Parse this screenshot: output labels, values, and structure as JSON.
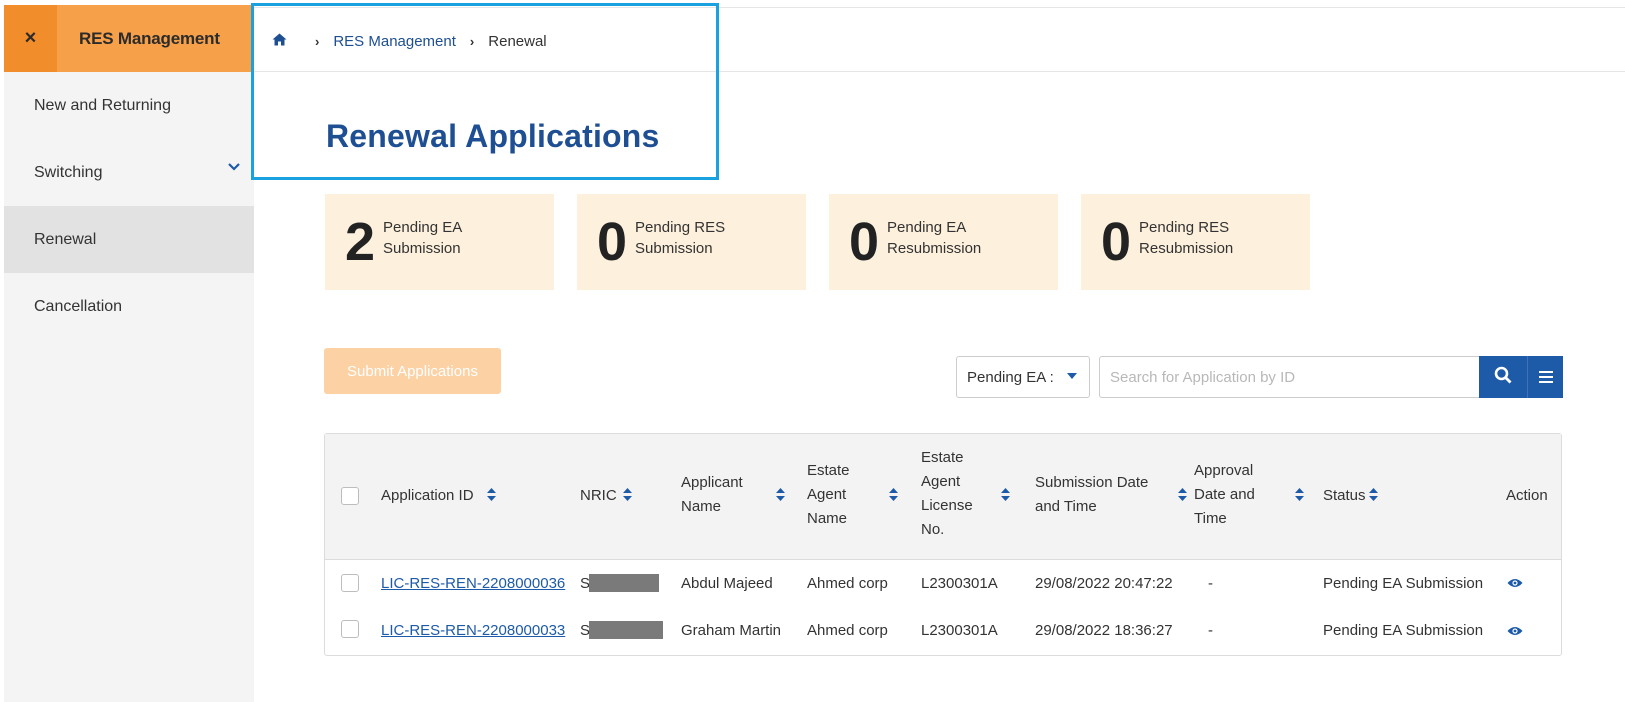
{
  "sidebar": {
    "close_icon": "×",
    "title": "RES Management",
    "items": [
      {
        "label": "New and Returning"
      },
      {
        "label": "Switching"
      },
      {
        "label": "Renewal"
      },
      {
        "label": "Cancellation"
      }
    ]
  },
  "breadcrumb": {
    "home_icon": "home-icon",
    "items": [
      "RES Management",
      "Renewal"
    ]
  },
  "page": {
    "title": "Renewal Applications"
  },
  "stats": [
    {
      "count": "2",
      "line1": "Pending EA",
      "line2": "Submission"
    },
    {
      "count": "0",
      "line1": "Pending RES",
      "line2": "Submission"
    },
    {
      "count": "0",
      "line1": "Pending EA",
      "line2": "Resubmission"
    },
    {
      "count": "0",
      "line1": "Pending RES",
      "line2": "Resubmission"
    }
  ],
  "controls": {
    "submit_label": "Submit Applications",
    "filter_value": "Pending EA :",
    "search_placeholder": "Search for Application by ID"
  },
  "table": {
    "headers": {
      "application_id": "Application ID",
      "nric": "NRIC",
      "applicant_1": "Applicant",
      "applicant_2": "Name",
      "agent_1": "Estate",
      "agent_2": "Agent",
      "agent_3": "Name",
      "license_1": "Estate",
      "license_2": "Agent",
      "license_3": "License",
      "license_4": "No.",
      "submission_1": "Submission Date",
      "submission_2": "and Time",
      "approval_1": "Approval",
      "approval_2": "Date and",
      "approval_3": "Time",
      "status": "Status",
      "action": "Action"
    },
    "rows": [
      {
        "id": "LIC-RES-REN-2208000036",
        "nric": "S",
        "applicant": "Abdul Majeed",
        "agent": "Ahmed corp",
        "license": "L2300301A",
        "submitted": "29/08/2022 20:47:22",
        "approval": "-",
        "status": "Pending EA Submission"
      },
      {
        "id": "LIC-RES-REN-2208000033",
        "nric": "S",
        "applicant": "Graham Martin",
        "agent": "Ahmed corp",
        "license": "L2300301A",
        "submitted": "29/08/2022 18:36:27",
        "approval": "-",
        "status": "Pending EA Submission"
      }
    ]
  },
  "colors": {
    "accent_orange": "#f7a04a",
    "primary_blue": "#1d5aa8",
    "title_blue": "#1f4f93",
    "card_bg": "#fdf0dc",
    "highlight": "#1aa1e0"
  }
}
